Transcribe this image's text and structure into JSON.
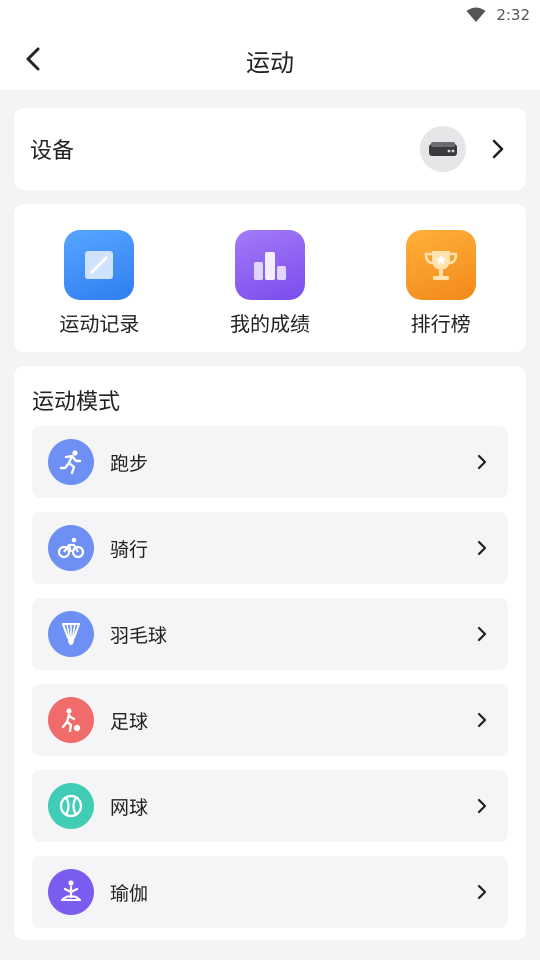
{
  "status_bar": {
    "time": "2:32",
    "wifi_icon": "wifi-icon"
  },
  "header": {
    "title": "运动",
    "back_icon": "back-arrow-icon"
  },
  "device": {
    "label": "设备",
    "icon": "device-icon"
  },
  "shortcuts": [
    {
      "label": "运动记录",
      "icon": "notebook-icon",
      "color": "#3d8bf5"
    },
    {
      "label": "我的成绩",
      "icon": "bar-chart-icon",
      "color": "#8d5cf0"
    },
    {
      "label": "排行榜",
      "icon": "trophy-icon",
      "color": "#f59a1b"
    }
  ],
  "modes": {
    "title": "运动模式",
    "items": [
      {
        "label": "跑步",
        "icon": "running-icon",
        "color": "#6e8ff3"
      },
      {
        "label": "骑行",
        "icon": "cycling-icon",
        "color": "#6e8ff3"
      },
      {
        "label": "羽毛球",
        "icon": "shuttlecock-icon",
        "color": "#6e8ff3"
      },
      {
        "label": "足球",
        "icon": "football-icon",
        "color": "#f26b6b"
      },
      {
        "label": "网球",
        "icon": "tennis-ball-icon",
        "color": "#41cdb5"
      },
      {
        "label": "瑜伽",
        "icon": "yoga-icon",
        "color": "#7b5cf0"
      }
    ]
  }
}
